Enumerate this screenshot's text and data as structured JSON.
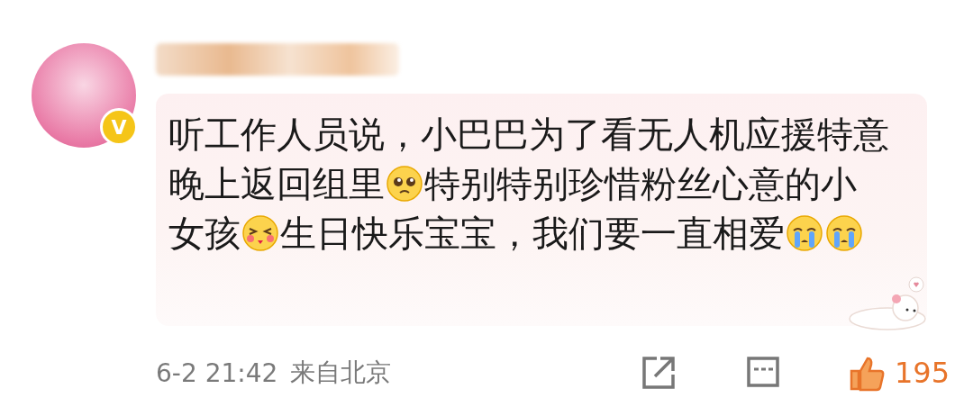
{
  "avatar": {
    "badge": "V"
  },
  "comment": {
    "segments": [
      {
        "kind": "text",
        "text": "听工作人员说，小巴巴为了看无人机应援特意晚上返回组里"
      },
      {
        "kind": "pleading"
      },
      {
        "kind": "text",
        "text": "特别特别珍惜粉丝心意的小女孩"
      },
      {
        "kind": "blush"
      },
      {
        "kind": "text",
        "text": "生日快乐宝宝，我们要一直相爱"
      },
      {
        "kind": "crying"
      },
      {
        "kind": "crying"
      }
    ]
  },
  "footer": {
    "time": "6-2 21:42",
    "location": "来自北京",
    "like": {
      "liked": true,
      "count": "195"
    }
  }
}
